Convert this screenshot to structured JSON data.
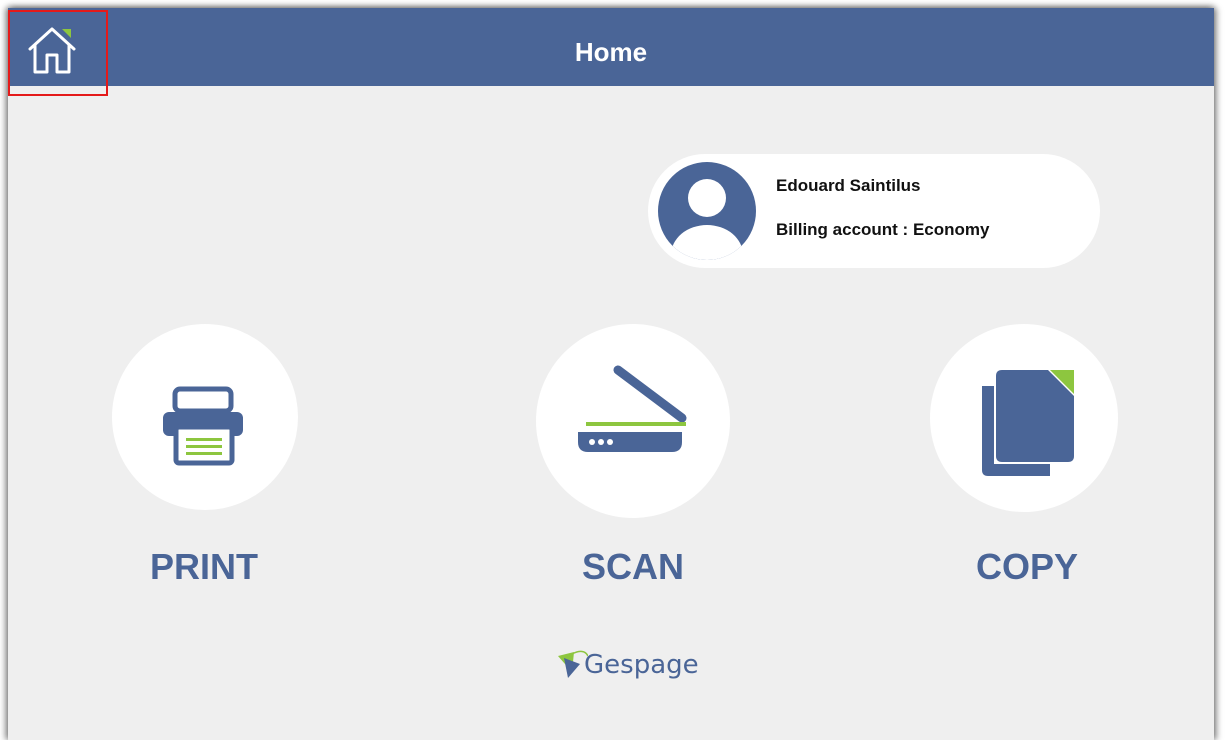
{
  "header": {
    "title": "Home",
    "home_icon": "home-icon",
    "background": "#4a6597"
  },
  "user": {
    "name": "Edouard Saintilus",
    "billing": "Billing account : Economy",
    "avatar_icon": "user-avatar-icon"
  },
  "actions": [
    {
      "label": "PRINT",
      "icon": "printer-icon"
    },
    {
      "label": "SCAN",
      "icon": "scanner-icon"
    },
    {
      "label": "COPY",
      "icon": "copy-icon"
    }
  ],
  "footer": {
    "logo_text": "Gespage"
  },
  "colors": {
    "accent": "#4a6597",
    "highlight": "#8dc63f",
    "background": "#efefef",
    "annotation": "#e41a1a"
  }
}
